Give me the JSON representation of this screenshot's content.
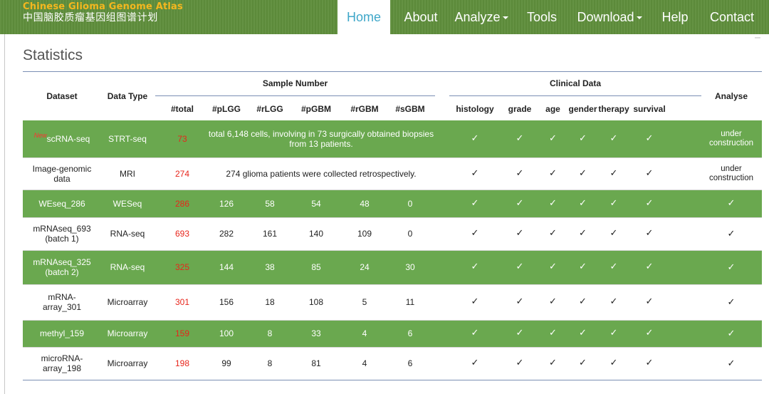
{
  "brand": {
    "en": "Chinese Glioma Genome Atlas",
    "zh": "中国脑胶质瘤基因组图谱计划"
  },
  "nav": {
    "home": "Home",
    "about": "About",
    "analyze": "Analyze",
    "tools": "Tools",
    "download": "Download",
    "help": "Help",
    "contact": "Contact"
  },
  "page_title": "Statistics",
  "table": {
    "headers": {
      "dataset": "Dataset",
      "data_type": "Data Type",
      "sample_number": "Sample Number",
      "clinical_data": "Clinical Data",
      "analyse": "Analyse",
      "sample_cols": [
        "#total",
        "#pLGG",
        "#rLGG",
        "#pGBM",
        "#rGBM",
        "#sGBM"
      ],
      "clinical_cols": [
        "histology",
        "grade",
        "age",
        "gender",
        "therapy",
        "survival"
      ]
    },
    "new_tag": "New",
    "check": "✓",
    "rows": [
      {
        "dataset": "scRNA-seq",
        "type": "STRT-seq",
        "total": "73",
        "note": "total 6,148 cells, involving in 73 surgically obtained biopsies from 13 patients.",
        "analyse": "under construction"
      },
      {
        "dataset": "Image-genomic data",
        "type": "MRI",
        "total": "274",
        "note": "274 glioma patients were collected retrospectively.",
        "analyse": "under construction"
      },
      {
        "dataset": "WEseq_286",
        "type": "WESeq",
        "total": "286",
        "pLGG": "126",
        "rLGG": "58",
        "pGBM": "54",
        "rGBM": "48",
        "sGBM": "0",
        "analyse": "✓"
      },
      {
        "dataset": "mRNAseq_693 (batch 1)",
        "type": "RNA-seq",
        "total": "693",
        "pLGG": "282",
        "rLGG": "161",
        "pGBM": "140",
        "rGBM": "109",
        "sGBM": "0",
        "analyse": "✓"
      },
      {
        "dataset": "mRNAseq_325 (batch 2)",
        "type": "RNA-seq",
        "total": "325",
        "pLGG": "144",
        "rLGG": "38",
        "pGBM": "85",
        "rGBM": "24",
        "sGBM": "30",
        "analyse": "✓"
      },
      {
        "dataset": "mRNA-array_301",
        "type": "Microarray",
        "total": "301",
        "pLGG": "156",
        "rLGG": "18",
        "pGBM": "108",
        "rGBM": "5",
        "sGBM": "11",
        "analyse": "✓"
      },
      {
        "dataset": "methyl_159",
        "type": "Microarray",
        "total": "159",
        "pLGG": "100",
        "rLGG": "8",
        "pGBM": "33",
        "rGBM": "4",
        "sGBM": "6",
        "analyse": "✓"
      },
      {
        "dataset": "microRNA-array_198",
        "type": "Microarray",
        "total": "198",
        "pLGG": "99",
        "rLGG": "8",
        "pGBM": "81",
        "rGBM": "4",
        "sGBM": "6",
        "analyse": "✓"
      }
    ]
  },
  "colors": {
    "nav_green": "#5f8e3c",
    "row_green": "#6aa84f",
    "brand_orange": "#f5b71e",
    "active_blue": "#3fa7c9",
    "total_red": "#e8251b",
    "rule_blue": "#7b8fb4"
  }
}
